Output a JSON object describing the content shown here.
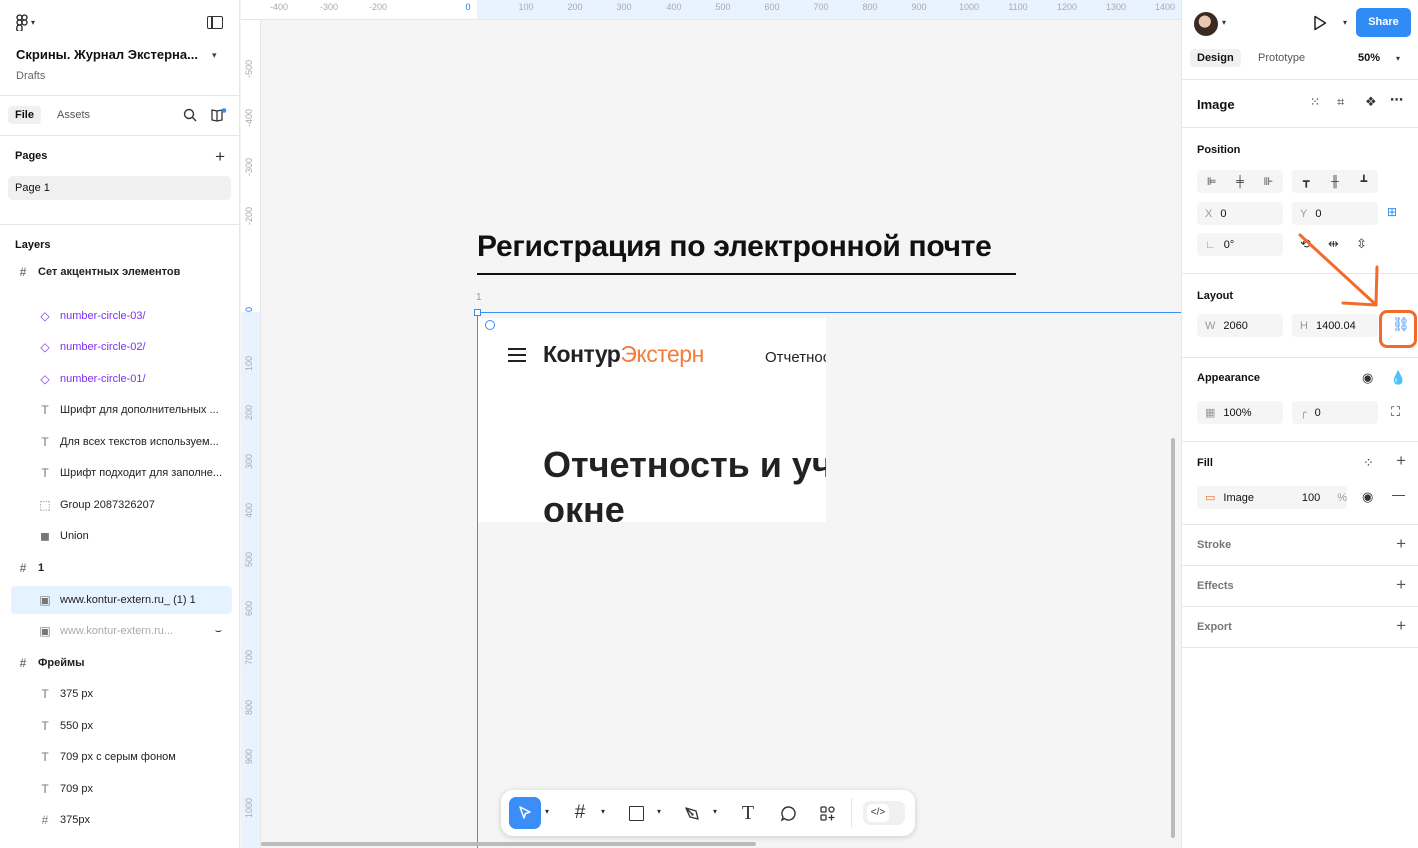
{
  "file": {
    "title": "Скрины. Журнал Экстерна...",
    "subtitle": "Drafts"
  },
  "left_tabs": {
    "file": "File",
    "assets": "Assets"
  },
  "pages": {
    "header": "Pages",
    "items": [
      "Page 1"
    ]
  },
  "layers": {
    "header": "Layers",
    "items": [
      {
        "label": "Сет акцентных элементов",
        "kind": "frame"
      },
      {
        "label": "number-circle-03/",
        "kind": "component"
      },
      {
        "label": "number-circle-02/",
        "kind": "component"
      },
      {
        "label": "number-circle-01/",
        "kind": "component"
      },
      {
        "label": "Шрифт для дополнительных ...",
        "kind": "text"
      },
      {
        "label": "Для всех текстов используем...",
        "kind": "text"
      },
      {
        "label": "Шрифт подходит для заполне...",
        "kind": "text"
      },
      {
        "label": "Group 2087326207",
        "kind": "group"
      },
      {
        "label": "Union",
        "kind": "union"
      },
      {
        "label": "1",
        "kind": "frame"
      },
      {
        "label": "www.kontur-extern.ru_ (1) 1",
        "kind": "image"
      },
      {
        "label": "www.kontur-extern.ru...",
        "kind": "image"
      },
      {
        "label": "Фреймы",
        "kind": "frame"
      },
      {
        "label": "375 px",
        "kind": "text"
      },
      {
        "label": "550 px",
        "kind": "text"
      },
      {
        "label": "709 px с серым фоном",
        "kind": "text"
      },
      {
        "label": "709 px",
        "kind": "text"
      },
      {
        "label": "375px",
        "kind": "frame"
      }
    ]
  },
  "ruler_top": [
    "-400",
    "-300",
    "-200",
    "0",
    "100",
    "200",
    "300",
    "400",
    "500",
    "600",
    "700",
    "800",
    "900",
    "1000",
    "1100",
    "1200",
    "1300",
    "1400"
  ],
  "ruler_left": [
    "-500",
    "-400",
    "-300",
    "-200",
    "0",
    "100",
    "200",
    "300",
    "400",
    "500",
    "600",
    "700",
    "800",
    "900",
    "1000"
  ],
  "canvas": {
    "heading": "Регистрация по электронной почте",
    "frame_label": "1",
    "preview": {
      "logo_main": "Контур",
      "logo_accent": "Экстерн",
      "nav_item": "Отчетность",
      "hero_line1": "Отчетность и уч",
      "hero_line2": "окне"
    }
  },
  "toolbar": {
    "tools": [
      "move-tool",
      "frame-tool",
      "shape-tool",
      "pen-tool",
      "text-tool",
      "comment-tool",
      "actions-tool",
      "dev-mode-toggle"
    ]
  },
  "help": "?",
  "right": {
    "share": "Share",
    "tabs": {
      "design": "Design",
      "prototype": "Prototype"
    },
    "zoom": "50%",
    "element_type": "Image",
    "position": {
      "title": "Position",
      "x_label": "X",
      "x": "0",
      "y_label": "Y",
      "y": "0",
      "rotation": "0°"
    },
    "layout": {
      "title": "Layout",
      "w_label": "W",
      "w": "2060",
      "h_label": "H",
      "h": "1400.04"
    },
    "appearance": {
      "title": "Appearance",
      "opacity": "100%",
      "radius": "0"
    },
    "fill": {
      "title": "Fill",
      "name": "Image",
      "opacity": "100",
      "pct": "%"
    },
    "stroke": "Stroke",
    "effects": "Effects",
    "export": "Export"
  },
  "annotation_color": "#f26b2a",
  "accent_color": "#2f8cf5",
  "component_color": "#7d2ff5"
}
